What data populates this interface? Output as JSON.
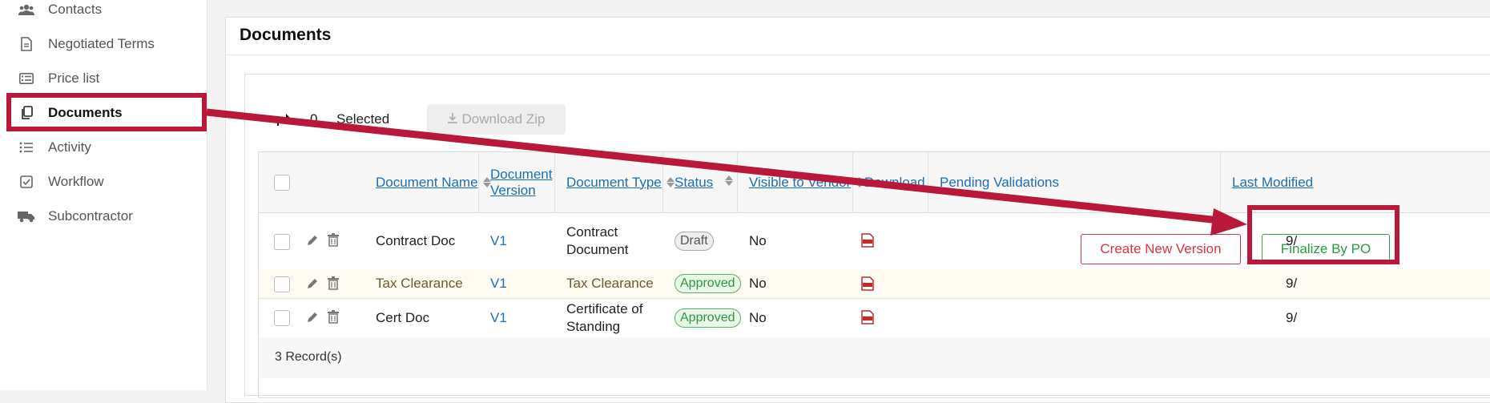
{
  "sidebar": {
    "items": [
      {
        "label": "Contacts",
        "icon": "users-icon"
      },
      {
        "label": "Negotiated Terms",
        "icon": "document-icon"
      },
      {
        "label": "Price list",
        "icon": "list-icon"
      },
      {
        "label": "Documents",
        "icon": "copy-icon",
        "active": true
      },
      {
        "label": "Activity",
        "icon": "list-bullets-icon"
      },
      {
        "label": "Workflow",
        "icon": "checkbox-icon"
      },
      {
        "label": "Subcontractor",
        "icon": "truck-icon"
      }
    ]
  },
  "card": {
    "title": "Documents"
  },
  "toolbar": {
    "selected_count": "0",
    "selected_label": "Selected",
    "download_zip_label": "Download Zip"
  },
  "table": {
    "headers": [
      "Document Name",
      "Document Version",
      "Document Type",
      "Status",
      "Visible to Vendor",
      "Download",
      "Pending Validations",
      "Last Modified"
    ],
    "rows": [
      {
        "name": "Contract Doc",
        "version": "V1",
        "type": "Contract Document",
        "status": "Draft",
        "visible": "No",
        "last_modified": "9/"
      },
      {
        "name": "Tax Clearance",
        "version": "V1",
        "type": "Tax Clearance",
        "status": "Approved",
        "visible": "No",
        "last_modified": "9/"
      },
      {
        "name": "Cert Doc",
        "version": "V1",
        "type": "Certificate of Standing",
        "status": "Approved",
        "visible": "No",
        "last_modified": "9/"
      }
    ],
    "actions": {
      "create_version": "Create New Version",
      "finalize": "Finalize By PO"
    },
    "footer": "3 Record(s)"
  },
  "colors": {
    "accent": "#1a6fb5",
    "annotation": "#b8193a",
    "danger": "#d9343f",
    "success": "#2b9a3b"
  }
}
